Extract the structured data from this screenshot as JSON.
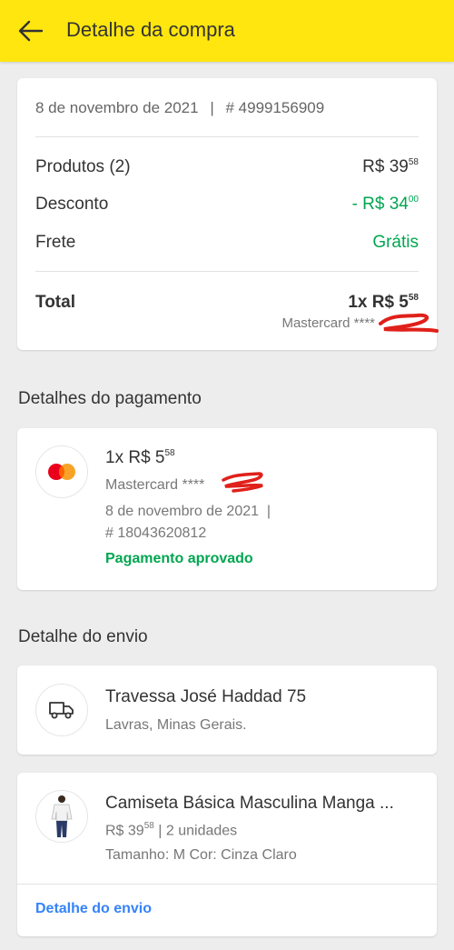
{
  "header": {
    "title": "Detalhe da compra",
    "back_icon": "arrow-left-icon",
    "background": "#ffe60f"
  },
  "summary": {
    "date": "8 de novembro de 2021",
    "separator": "|",
    "order_number": "# 4999156909",
    "products_label": "Produtos (2)",
    "products_value": "R$ 39",
    "products_cents": "58",
    "discount_label": "Desconto",
    "discount_value": "- R$ 34",
    "discount_cents": "00",
    "shipping_label": "Frete",
    "shipping_value": "Grátis",
    "total_label": "Total",
    "total_value": "1x R$ 5",
    "total_cents": "58",
    "payment_method": "Mastercard ****"
  },
  "payment_section": {
    "title": "Detalhes do pagamento",
    "icon": "mastercard-icon",
    "amount": "1x R$ 5",
    "amount_cents": "58",
    "card": "Mastercard ****",
    "date": "8 de novembro de 2021  |",
    "operation": "# 18043620812",
    "status": "Pagamento aprovado"
  },
  "shipping_section": {
    "title": "Detalhe do envio",
    "icon": "truck-icon",
    "street": "Travessa José Haddad 75",
    "city": "Lavras, Minas Gerais."
  },
  "product": {
    "image": "product-thumbnail",
    "title": "Camiseta Básica Masculina Manga ...",
    "price": "R$ 39",
    "price_cents": "58",
    "quantity": "| 2 unidades",
    "attributes": "Tamanho: M Cor: Cinza Claro",
    "link": "Detalhe do envio"
  },
  "colors": {
    "accent_green": "#00a650",
    "link_blue": "#3483fa",
    "redaction_red": "#e0201a"
  }
}
